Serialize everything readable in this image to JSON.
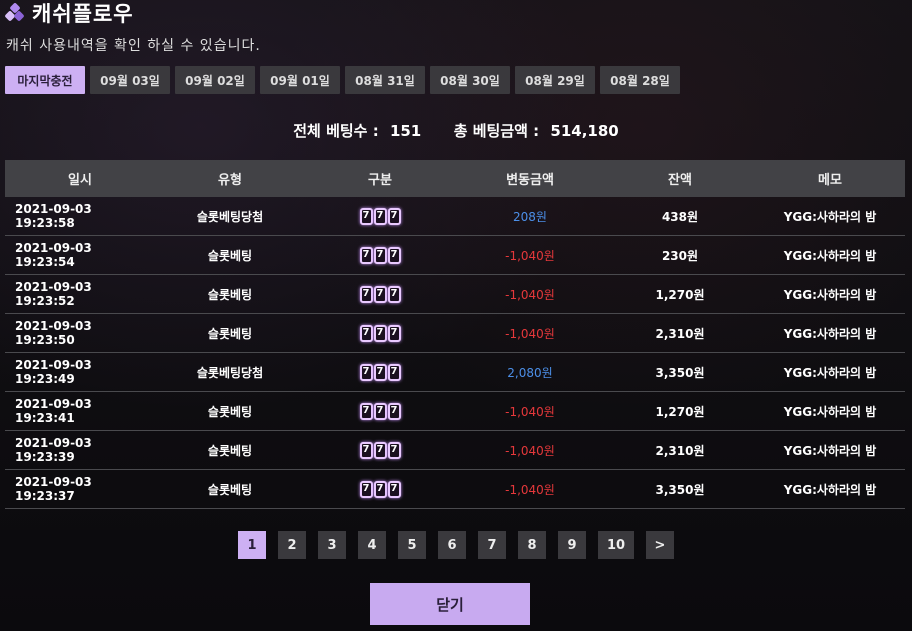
{
  "header": {
    "title": "캐쉬플로우",
    "subtitle": "캐쉬 사용내역을 확인 하실 수 있습니다.",
    "logo_icon": "cube-logo-icon"
  },
  "tabs": [
    {
      "label": "마지막충전",
      "active": true
    },
    {
      "label": "09월 03일",
      "active": false
    },
    {
      "label": "09월 02일",
      "active": false
    },
    {
      "label": "09월 01일",
      "active": false
    },
    {
      "label": "08월 31일",
      "active": false
    },
    {
      "label": "08월 30일",
      "active": false
    },
    {
      "label": "08월 29일",
      "active": false
    },
    {
      "label": "08월 28일",
      "active": false
    }
  ],
  "summary": {
    "bet_count_label": "전체 베팅수 :",
    "bet_count": "151",
    "bet_total_label": "총 베팅금액 :",
    "bet_total": "514,180"
  },
  "table": {
    "headers": [
      "일시",
      "유형",
      "구분",
      "변동금액",
      "잔액",
      "메모"
    ],
    "rows": [
      {
        "datetime": "2021-09-03 19:23:58",
        "type": "슬롯베팅당첨",
        "category_icon": "slot-777-icon",
        "amount": "208원",
        "sign": "pos",
        "balance": "438원",
        "memo": "YGG:사하라의 밤"
      },
      {
        "datetime": "2021-09-03 19:23:54",
        "type": "슬롯베팅",
        "category_icon": "slot-777-icon",
        "amount": "-1,040원",
        "sign": "neg",
        "balance": "230원",
        "memo": "YGG:사하라의 밤"
      },
      {
        "datetime": "2021-09-03 19:23:52",
        "type": "슬롯베팅",
        "category_icon": "slot-777-icon",
        "amount": "-1,040원",
        "sign": "neg",
        "balance": "1,270원",
        "memo": "YGG:사하라의 밤"
      },
      {
        "datetime": "2021-09-03 19:23:50",
        "type": "슬롯베팅",
        "category_icon": "slot-777-icon",
        "amount": "-1,040원",
        "sign": "neg",
        "balance": "2,310원",
        "memo": "YGG:사하라의 밤"
      },
      {
        "datetime": "2021-09-03 19:23:49",
        "type": "슬롯베팅당첨",
        "category_icon": "slot-777-icon",
        "amount": "2,080원",
        "sign": "pos",
        "balance": "3,350원",
        "memo": "YGG:사하라의 밤"
      },
      {
        "datetime": "2021-09-03 19:23:41",
        "type": "슬롯베팅",
        "category_icon": "slot-777-icon",
        "amount": "-1,040원",
        "sign": "neg",
        "balance": "1,270원",
        "memo": "YGG:사하라의 밤"
      },
      {
        "datetime": "2021-09-03 19:23:39",
        "type": "슬롯베팅",
        "category_icon": "slot-777-icon",
        "amount": "-1,040원",
        "sign": "neg",
        "balance": "2,310원",
        "memo": "YGG:사하라의 밤"
      },
      {
        "datetime": "2021-09-03 19:23:37",
        "type": "슬롯베팅",
        "category_icon": "slot-777-icon",
        "amount": "-1,040원",
        "sign": "neg",
        "balance": "3,350원",
        "memo": "YGG:사하라의 밤"
      }
    ]
  },
  "pagination": {
    "pages": [
      "1",
      "2",
      "3",
      "4",
      "5",
      "6",
      "7",
      "8",
      "9",
      "10"
    ],
    "current": "1",
    "next_label": ">"
  },
  "close_button": {
    "label": "닫기"
  },
  "colors": {
    "accent": "#cdb0f3",
    "positive": "#4c8fe8",
    "negative": "#e5383b",
    "header_bg": "#424246"
  }
}
